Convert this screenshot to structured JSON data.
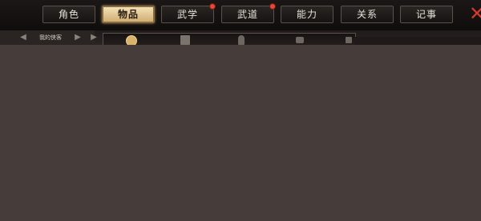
{
  "tabs": [
    {
      "label": "角色",
      "active": false,
      "badge": false
    },
    {
      "label": "物品",
      "active": true,
      "badge": false
    },
    {
      "label": "武学",
      "active": false,
      "badge": true
    },
    {
      "label": "武道",
      "active": false,
      "badge": true
    },
    {
      "label": "能力",
      "active": false,
      "badge": false
    },
    {
      "label": "关系",
      "active": false,
      "badge": false
    },
    {
      "label": "记事",
      "active": false,
      "badge": false
    }
  ],
  "hero_selector": {
    "label": "我的侠客"
  },
  "colors": {
    "accent": "#cfae72",
    "badge": "#e04a3a",
    "close": "#d23a2c"
  }
}
